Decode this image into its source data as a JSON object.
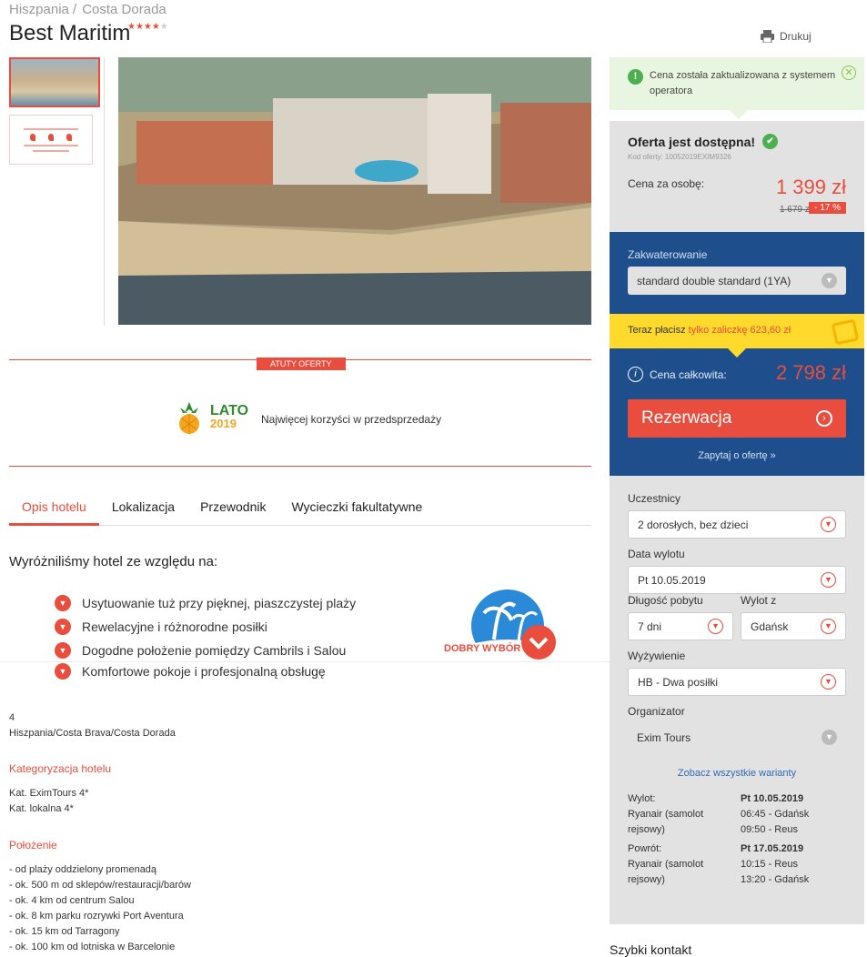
{
  "breadcrumb": [
    "Hiszpania /",
    "Costa Dorada"
  ],
  "hotel": {
    "name": "Best Maritim",
    "stars_filled": "★★★★",
    "stars_empty": "★"
  },
  "print_label": "Drukuj",
  "badge_label": "ATUTY OFERTY",
  "lato": {
    "title": "LATO",
    "year": "2019",
    "desc": "Najwięcej korzyści w przedsprzedaży"
  },
  "tabs": [
    "Opis hotelu",
    "Lokalizacja",
    "Przewodnik",
    "Wycieczki fakultatywne"
  ],
  "features_heading": "Wyróżniliśmy hotel ze względu na:",
  "features": [
    "Usytuowanie tuż przy pięknej, piaszczystej plaży",
    "Rewelacyjne i różnorodne posiłki",
    "Dogodne położenie pomiędzy Cambrils i Salou",
    "Komfortowe pokoje i profesjonalną obsługę"
  ],
  "dobry_label": "DOBRY WYBÓR",
  "info": {
    "stars": "4",
    "region": "Hiszpania/Costa Brava/Costa Dorada",
    "cat_h": "Kategoryzacja hotelu",
    "cat1": "Kat. EximTours 4*",
    "cat2": "Kat. lokalna 4*",
    "pol_h": "Położenie",
    "pol": [
      "- od plaży oddzielony promenadą",
      "- ok. 500 m od sklepów/restauracji/barów",
      "- ok. 4 km od centrum Salou",
      "- ok. 8 km parku rozrywki Port Aventura",
      "- ok. 15 km od Tarragony",
      "- ok. 100 km od lotniska w Barcelonie"
    ]
  },
  "sidebar": {
    "notice": "Cena została zaktualizowana z systemem operatora",
    "avail": "Oferta jest dostępna!",
    "code": "Kod oferty: 10052019EXIM9326",
    "per_person_label": "Cena za osobę:",
    "price": "1 399 zł",
    "old_price": "1 679 zł",
    "discount": "- 17 %",
    "accom_label": "Zakwaterowanie",
    "accom_value": "standard double standard (1YA)",
    "zal_prefix": "Teraz płacisz",
    "zal_value": "tylko zaliczkę 623,60 zł",
    "total_label": "Cena całkowita:",
    "total": "2 798 zł",
    "rez": "Rezerwacja",
    "ask": "Zapytaj o ofertę »",
    "uczestnicy_l": "Uczestnicy",
    "uczestnicy": "2 dorosłych, bez dzieci",
    "data_l": "Data wylotu",
    "data": "Pt 10.05.2019",
    "dl_l": "Długość pobytu",
    "dl": "7 dni",
    "wylot_l": "Wylot z",
    "wylot": "Gdańsk",
    "wyz_l": "Wyżywienie",
    "wyz": "HB - Dwa posiłki",
    "org_l": "Organizator",
    "org": "Exim Tours",
    "all": "Zobacz wszystkie warianty",
    "f_w_l": "Wylot:",
    "f_w_d": "Pt 10.05.2019",
    "f_w_a": "Ryanair (samolot rejsowy)",
    "f_w_t1": "06:45 - Gdańsk",
    "f_w_t2": "09:50 - Reus",
    "f_p_l": "Powrót:",
    "f_p_d": "Pt 17.05.2019",
    "f_p_a": "Ryanair (samolot rejsowy)",
    "f_p_t1": "10:15 - Reus",
    "f_p_t2": "13:20 - Gdańsk"
  },
  "szybki": "Szybki kontakt"
}
